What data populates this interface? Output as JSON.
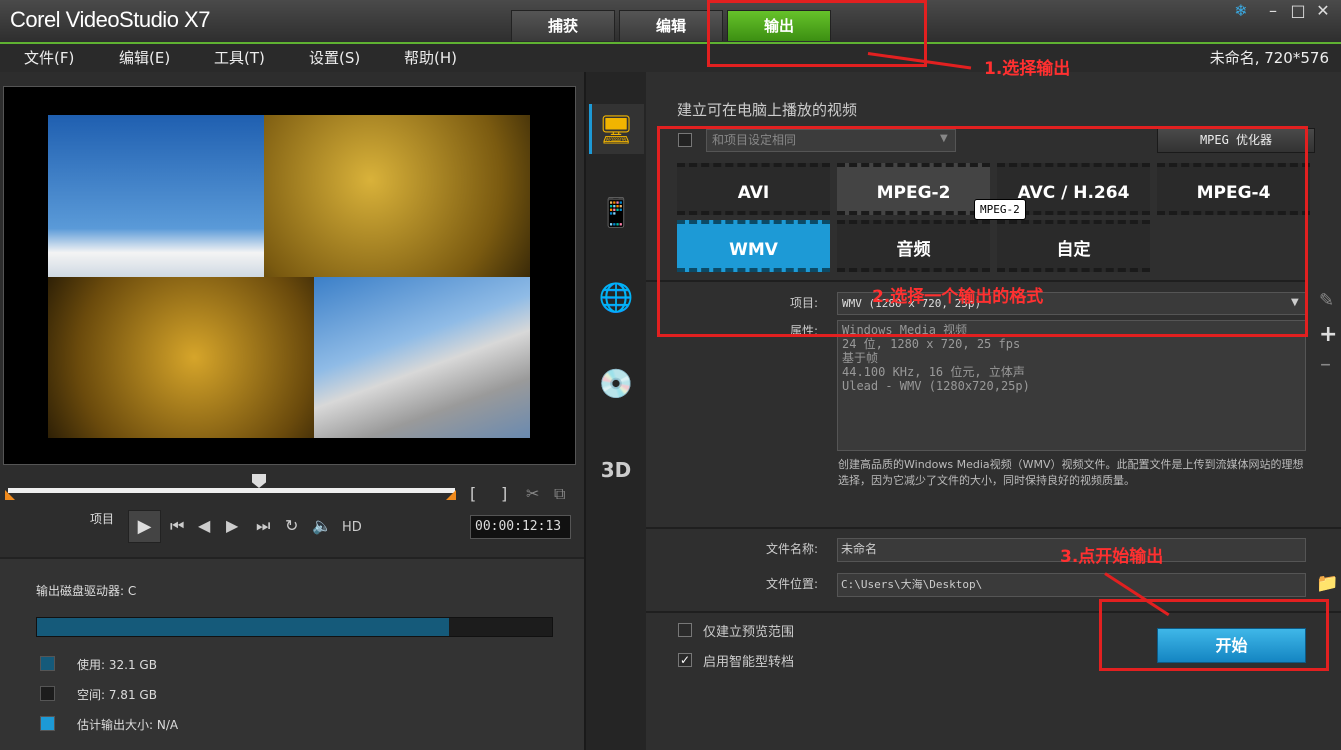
{
  "window": {
    "title": "Corel VideoStudio X7",
    "project_info": "未命名, 720*576"
  },
  "tabs": [
    {
      "label": "捕获"
    },
    {
      "label": "编辑"
    },
    {
      "label": "输出"
    }
  ],
  "menu": [
    {
      "label": "文件(F)"
    },
    {
      "label": "编辑(E)"
    },
    {
      "label": "工具(T)"
    },
    {
      "label": "设置(S)"
    },
    {
      "label": "帮助(H)"
    }
  ],
  "player": {
    "mode_label": "项目",
    "timecode": "00:00:12:13",
    "hd": "HD",
    "mark_in": "[",
    "mark_out": "]"
  },
  "disk": {
    "label": "输出磁盘驱动器: C",
    "used_fraction": 0.8,
    "used": "使用: 32.1 GB",
    "free": "空间: 7.81 GB",
    "estimate": "估计输出大小: N/A",
    "colors": {
      "used": "#155a7a",
      "free": "#1c1c1c",
      "estimate": "#1d9ad6"
    }
  },
  "output": {
    "heading": "建立可在电脑上播放的视频",
    "preset_placeholder": "和项目设定相同",
    "optimizer": "MPEG 优化器",
    "formats": [
      {
        "label": "AVI"
      },
      {
        "label": "MPEG-2"
      },
      {
        "label": "AVC / H.264"
      },
      {
        "label": "MPEG-4"
      },
      {
        "label": "WMV"
      },
      {
        "label": "音频"
      },
      {
        "label": "自定"
      }
    ],
    "selected_format": "WMV",
    "tooltip": "MPEG-2",
    "item_label": "项目:",
    "item_value": "WMV (1280 x 720, 25p)",
    "props_label": "属性:",
    "props_text": "Windows Media 视频\n24 位, 1280 x 720, 25 fps\n基于帧\n44.100 KHz, 16 位元, 立体声\nUlead - WMV (1280x720,25p)",
    "description": "创建高品质的Windows Media视频（WMV）视频文件。此配置文件是上传到流媒体网站的理想选择，因为它减少了文件的大小，同时保持良好的视频质量。",
    "filename_label": "文件名称:",
    "filename": "未命名",
    "location_label": "文件位置:",
    "location": "C:\\Users\\大海\\Desktop\\",
    "preview_only": "仅建立预览范围",
    "smart_render": "启用智能型转档",
    "start": "开始"
  },
  "annotations": {
    "step1": "1.选择输出",
    "step2": "2.选择一个输出的格式",
    "step3": "3.点开始输出",
    "color": "#e22020"
  }
}
